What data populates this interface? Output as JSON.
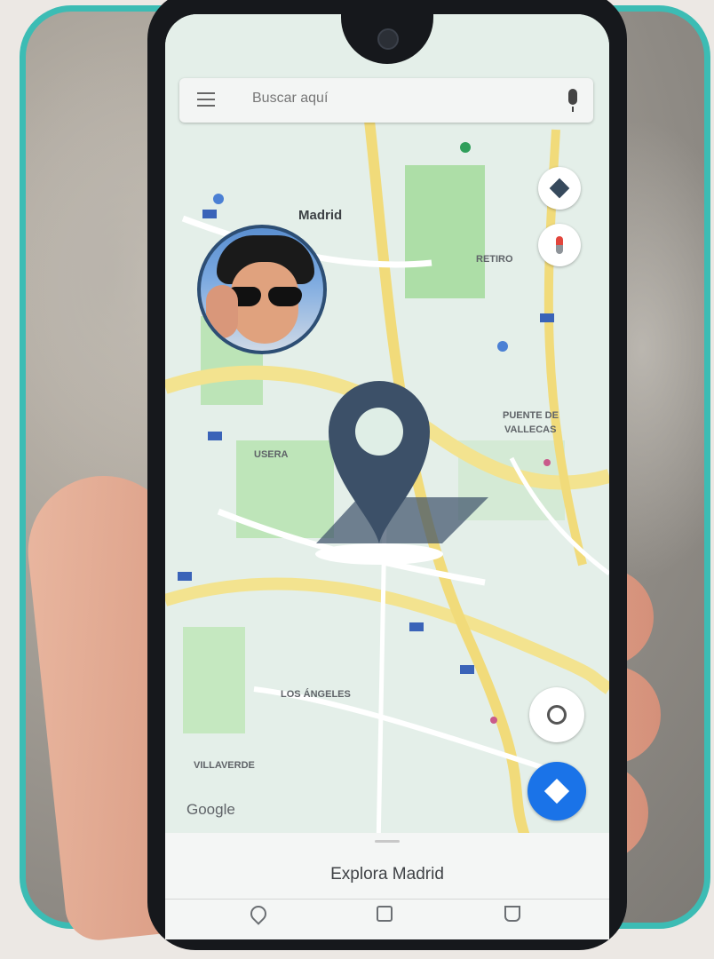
{
  "search": {
    "placeholder": "Buscar aquí"
  },
  "map": {
    "city_label": "Madrid",
    "district_labels": [
      "PUENTE DE",
      "VALLECAS",
      "USERA",
      "VILLAVERDE",
      "LOS ÁNGELES",
      "RETIRO"
    ],
    "attribution": "Google"
  },
  "bottom_sheet": {
    "title": "Explora Madrid",
    "nav_icons": [
      "explore-icon",
      "commute-icon",
      "saved-icon"
    ]
  },
  "status_bar": {
    "left": "",
    "right": ""
  },
  "colors": {
    "frame_border": "#3cbcb4",
    "pin_color": "#3c5068",
    "fab_blue": "#1a73e8"
  }
}
